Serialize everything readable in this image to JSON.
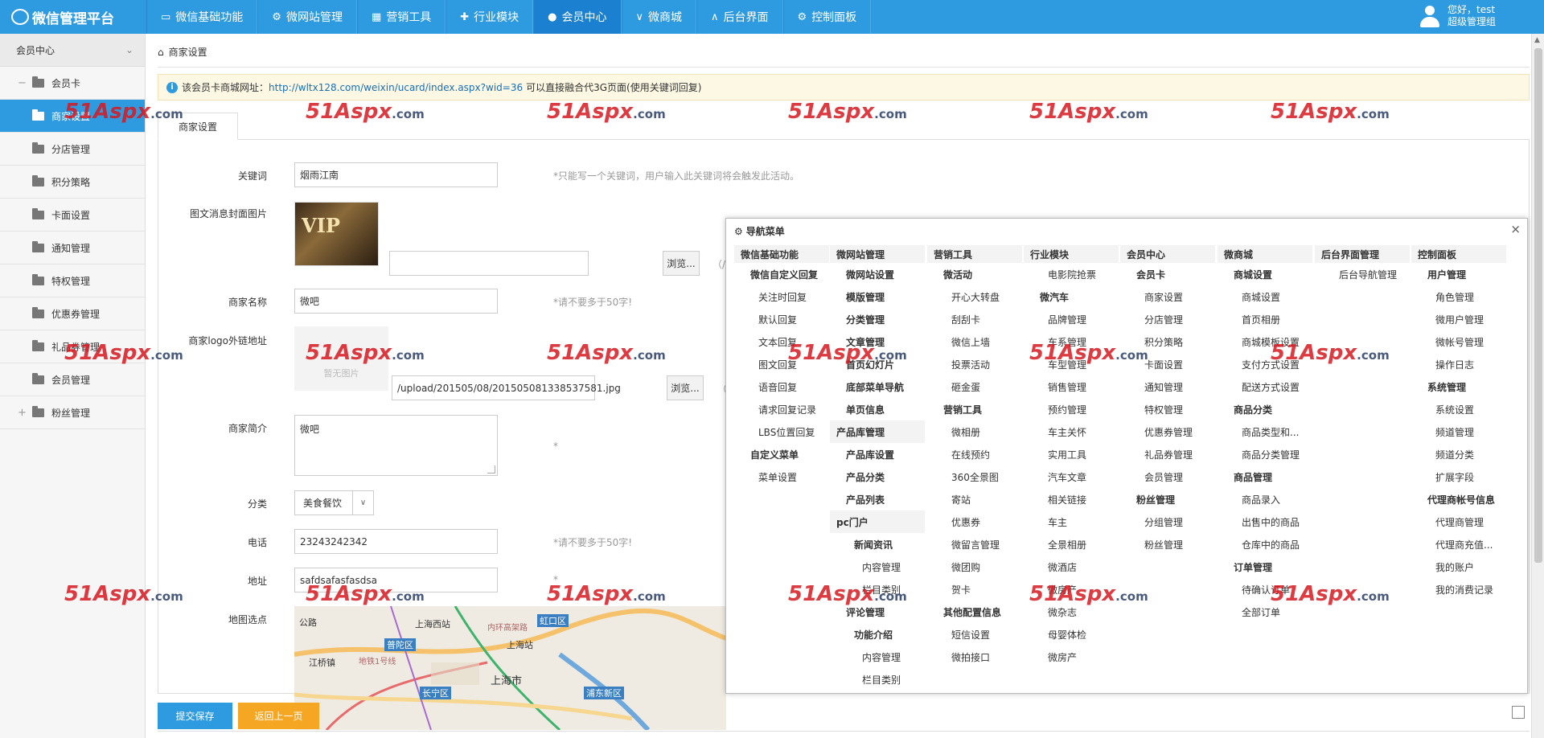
{
  "app": {
    "title": "微信管理平台",
    "brand_color": "#2e9be0"
  },
  "nav": [
    "微信基础功能",
    "微网站管理",
    "营销工具",
    "行业模块",
    "会员中心",
    "微商城",
    "后台界面",
    "控制面板"
  ],
  "user": {
    "greeting": "您好，test",
    "role": "超级管理组"
  },
  "sidebar": {
    "head": "会员中心",
    "group1": "会员卡",
    "items": [
      "商家设置",
      "分店管理",
      "积分策略",
      "卡面设置",
      "通知管理",
      "特权管理",
      "优惠券管理",
      "礼品券管理",
      "会员管理"
    ],
    "group2": "粉丝管理"
  },
  "breadcrumb": "商家设置",
  "notice": {
    "prefix": "该会员卡商城网址：",
    "url": "http://wltx128.com/weixin/ucard/index.aspx?wid=36",
    "suffix": "可以直接融合代3G页面(使用关键词回复)"
  },
  "tab": "商家设置",
  "form": {
    "keyword_label": "关键词",
    "keyword_value": "烟雨江南",
    "keyword_hint": "*只能写一个关键词，用户输入此关键词将会触发此活动。",
    "cover_label": "图文消息封面图片",
    "vip_text": "VIP",
    "browse": "浏览...",
    "paren": "（/",
    "name_label": "商家名称",
    "name_value": "微吧",
    "name_hint": "*请不要多于50字!",
    "logo_label": "商家logo外链地址",
    "logo_placeholder": "暂无图片",
    "logo_value": "/upload/201505/08/201505081338537581.jpg",
    "paren2": "（",
    "intro_label": "商家简介",
    "intro_value": "微吧",
    "star": "*",
    "category_label": "分类",
    "category_value": "美食餐饮",
    "phone_label": "电话",
    "phone_value": "23243242342",
    "phone_hint": "*请不要多于50字!",
    "address_label": "地址",
    "address_value": "safdsafasfasdsa",
    "map_label": "地图选点",
    "map_places": [
      "公路",
      "上海西站",
      "内环高架路",
      "虹口区",
      "普陀区",
      "上海站",
      "地铁1号线",
      "江桥镇",
      "上海市",
      "长宁区",
      "浦东新区"
    ]
  },
  "buttons": {
    "submit": "提交保存",
    "back": "返回上一页"
  },
  "popup": {
    "title": "导航菜单",
    "columns": [
      {
        "head": "微信基础功能",
        "items": [
          {
            "t": "微信自定义回复",
            "k": "g"
          },
          {
            "t": "关注时回复",
            "k": "s"
          },
          {
            "t": "默认回复",
            "k": "s"
          },
          {
            "t": "文本回复",
            "k": "s"
          },
          {
            "t": "图文回复",
            "k": "s"
          },
          {
            "t": "语音回复",
            "k": "s"
          },
          {
            "t": "请求回复记录",
            "k": "s"
          },
          {
            "t": "LBS位置回复",
            "k": "s"
          },
          {
            "t": "自定义菜单",
            "k": "g"
          },
          {
            "t": "菜单设置",
            "k": "s"
          }
        ]
      },
      {
        "head": "微网站管理",
        "items": [
          {
            "t": "微网站设置",
            "k": "g"
          },
          {
            "t": "模版管理",
            "k": "g"
          },
          {
            "t": "分类管理",
            "k": "g"
          },
          {
            "t": "文章管理",
            "k": "g"
          },
          {
            "t": "首页幻灯片",
            "k": "g"
          },
          {
            "t": "底部菜单导航",
            "k": "g"
          },
          {
            "t": "单页信息",
            "k": "g"
          },
          {
            "t": "产品库管理",
            "k": "h"
          },
          {
            "t": "产品库设置",
            "k": "g"
          },
          {
            "t": "产品分类",
            "k": "g"
          },
          {
            "t": "产品列表",
            "k": "g"
          },
          {
            "t": "pc门户",
            "k": "h"
          },
          {
            "t": "新闻资讯",
            "k": "gb"
          },
          {
            "t": "内容管理",
            "k": "t"
          },
          {
            "t": "栏目类别",
            "k": "t"
          },
          {
            "t": "评论管理",
            "k": "g"
          },
          {
            "t": "功能介绍",
            "k": "gb"
          },
          {
            "t": "内容管理",
            "k": "t"
          },
          {
            "t": "栏目类别",
            "k": "t"
          }
        ]
      },
      {
        "head": "营销工具",
        "items": [
          {
            "t": "微活动",
            "k": "g"
          },
          {
            "t": "开心大转盘",
            "k": "s"
          },
          {
            "t": "刮刮卡",
            "k": "s"
          },
          {
            "t": "微信上墙",
            "k": "s"
          },
          {
            "t": "投票活动",
            "k": "s"
          },
          {
            "t": "砸金蛋",
            "k": "s"
          },
          {
            "t": "营销工具",
            "k": "g"
          },
          {
            "t": "微相册",
            "k": "s"
          },
          {
            "t": "在线预约",
            "k": "s"
          },
          {
            "t": "360全景图",
            "k": "s"
          },
          {
            "t": "寄站",
            "k": "s"
          },
          {
            "t": "优惠券",
            "k": "s"
          },
          {
            "t": "微留言管理",
            "k": "s"
          },
          {
            "t": "微团购",
            "k": "s"
          },
          {
            "t": "贺卡",
            "k": "s"
          },
          {
            "t": "其他配置信息",
            "k": "g"
          },
          {
            "t": "短信设置",
            "k": "s"
          },
          {
            "t": "微拍接口",
            "k": "s"
          }
        ]
      },
      {
        "head": "行业模块",
        "items": [
          {
            "t": "电影院抢票",
            "k": "g0"
          },
          {
            "t": "微汽车",
            "k": "g"
          },
          {
            "t": "品牌管理",
            "k": "s"
          },
          {
            "t": "车系管理",
            "k": "s"
          },
          {
            "t": "车型管理",
            "k": "s"
          },
          {
            "t": "销售管理",
            "k": "s"
          },
          {
            "t": "预约管理",
            "k": "s"
          },
          {
            "t": "车主关怀",
            "k": "s"
          },
          {
            "t": "实用工具",
            "k": "s"
          },
          {
            "t": "汽车文章",
            "k": "s"
          },
          {
            "t": "相关链接",
            "k": "s"
          },
          {
            "t": "车主",
            "k": "s"
          },
          {
            "t": "全景相册",
            "k": "s"
          },
          {
            "t": "微酒店",
            "k": "g0"
          },
          {
            "t": "微房产",
            "k": "g0"
          },
          {
            "t": "微杂志",
            "k": "g0"
          },
          {
            "t": "母婴体检",
            "k": "g0"
          },
          {
            "t": "微房产",
            "k": "g0"
          }
        ]
      },
      {
        "head": "会员中心",
        "items": [
          {
            "t": "会员卡",
            "k": "g"
          },
          {
            "t": "商家设置",
            "k": "s"
          },
          {
            "t": "分店管理",
            "k": "s"
          },
          {
            "t": "积分策略",
            "k": "s"
          },
          {
            "t": "卡面设置",
            "k": "s"
          },
          {
            "t": "通知管理",
            "k": "s"
          },
          {
            "t": "特权管理",
            "k": "s"
          },
          {
            "t": "优惠券管理",
            "k": "s"
          },
          {
            "t": "礼品券管理",
            "k": "s"
          },
          {
            "t": "会员管理",
            "k": "s"
          },
          {
            "t": "粉丝管理",
            "k": "g"
          },
          {
            "t": "分组管理",
            "k": "s"
          },
          {
            "t": "粉丝管理",
            "k": "s"
          }
        ]
      },
      {
        "head": "微商城",
        "items": [
          {
            "t": "商城设置",
            "k": "g"
          },
          {
            "t": "商城设置",
            "k": "s"
          },
          {
            "t": "首页相册",
            "k": "s"
          },
          {
            "t": "商城模板设置",
            "k": "s"
          },
          {
            "t": "支付方式设置",
            "k": "s"
          },
          {
            "t": "配送方式设置",
            "k": "s"
          },
          {
            "t": "商品分类",
            "k": "g"
          },
          {
            "t": "商品类型和...",
            "k": "s"
          },
          {
            "t": "商品分类管理",
            "k": "s"
          },
          {
            "t": "商品管理",
            "k": "g"
          },
          {
            "t": "商品录入",
            "k": "s"
          },
          {
            "t": "出售中的商品",
            "k": "s"
          },
          {
            "t": "仓库中的商品",
            "k": "s"
          },
          {
            "t": "订单管理",
            "k": "g"
          },
          {
            "t": "待确认订单",
            "k": "s"
          },
          {
            "t": "全部订单",
            "k": "s"
          }
        ]
      },
      {
        "head": "后台界面管理",
        "items": [
          {
            "t": "后台导航管理",
            "k": "g0"
          }
        ]
      },
      {
        "head": "控制面板",
        "items": [
          {
            "t": "用户管理",
            "k": "g"
          },
          {
            "t": "角色管理",
            "k": "s"
          },
          {
            "t": "微用户管理",
            "k": "s"
          },
          {
            "t": "微帐号管理",
            "k": "s"
          },
          {
            "t": "操作日志",
            "k": "s"
          },
          {
            "t": "系统管理",
            "k": "g"
          },
          {
            "t": "系统设置",
            "k": "s"
          },
          {
            "t": "频道管理",
            "k": "s"
          },
          {
            "t": "频道分类",
            "k": "s"
          },
          {
            "t": "扩展字段",
            "k": "s"
          },
          {
            "t": "代理商帐号信息",
            "k": "g"
          },
          {
            "t": "代理商管理",
            "k": "s"
          },
          {
            "t": "代理商充值...",
            "k": "s"
          },
          {
            "t": "我的账户",
            "k": "s"
          },
          {
            "t": "我的消费记录",
            "k": "s"
          }
        ]
      }
    ]
  },
  "watermark": {
    "brand": "51Aspx",
    "suffix": ".com"
  }
}
